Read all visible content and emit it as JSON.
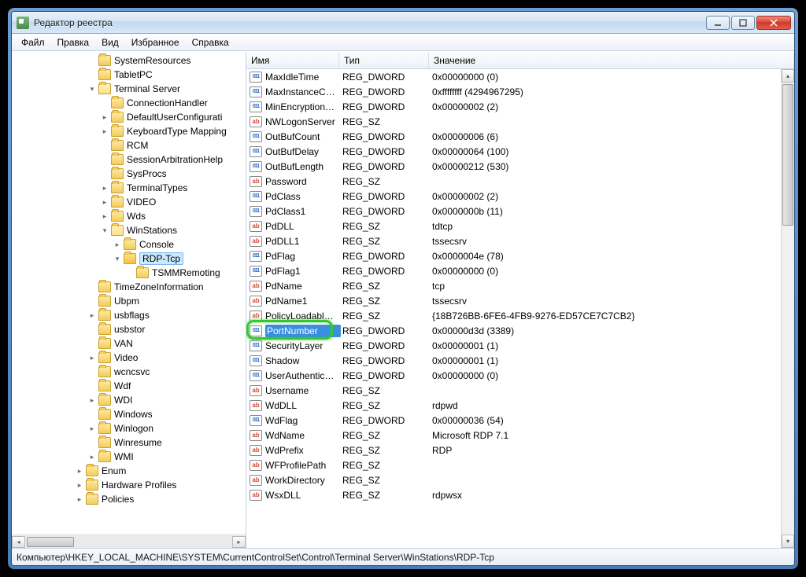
{
  "window": {
    "title": "Редактор реестра"
  },
  "menu": {
    "file": "Файл",
    "edit": "Правка",
    "view": "Вид",
    "favorites": "Избранное",
    "help": "Справка"
  },
  "headers": {
    "name": "Имя",
    "type": "Тип",
    "value": "Значение"
  },
  "tree": [
    {
      "depth": 6,
      "exp": "",
      "label": "SystemResources"
    },
    {
      "depth": 6,
      "exp": "",
      "label": "TabletPC"
    },
    {
      "depth": 6,
      "exp": "▾",
      "label": "Terminal Server",
      "open": true
    },
    {
      "depth": 7,
      "exp": "",
      "label": "ConnectionHandler"
    },
    {
      "depth": 7,
      "exp": "▸",
      "label": "DefaultUserConfigurati"
    },
    {
      "depth": 7,
      "exp": "▸",
      "label": "KeyboardType Mapping"
    },
    {
      "depth": 7,
      "exp": "",
      "label": "RCM"
    },
    {
      "depth": 7,
      "exp": "",
      "label": "SessionArbitrationHelp"
    },
    {
      "depth": 7,
      "exp": "",
      "label": "SysProcs"
    },
    {
      "depth": 7,
      "exp": "▸",
      "label": "TerminalTypes"
    },
    {
      "depth": 7,
      "exp": "▸",
      "label": "VIDEO"
    },
    {
      "depth": 7,
      "exp": "▸",
      "label": "Wds"
    },
    {
      "depth": 7,
      "exp": "▾",
      "label": "WinStations",
      "open": true
    },
    {
      "depth": 8,
      "exp": "▸",
      "label": "Console"
    },
    {
      "depth": 8,
      "exp": "▾",
      "label": "RDP-Tcp",
      "open": true,
      "selected": true
    },
    {
      "depth": 9,
      "exp": "",
      "label": "TSMMRemoting"
    },
    {
      "depth": 6,
      "exp": "",
      "label": "TimeZoneInformation"
    },
    {
      "depth": 6,
      "exp": "",
      "label": "Ubpm"
    },
    {
      "depth": 6,
      "exp": "▸",
      "label": "usbflags"
    },
    {
      "depth": 6,
      "exp": "",
      "label": "usbstor"
    },
    {
      "depth": 6,
      "exp": "",
      "label": "VAN"
    },
    {
      "depth": 6,
      "exp": "▸",
      "label": "Video"
    },
    {
      "depth": 6,
      "exp": "",
      "label": "wcncsvc"
    },
    {
      "depth": 6,
      "exp": "",
      "label": "Wdf"
    },
    {
      "depth": 6,
      "exp": "▸",
      "label": "WDI"
    },
    {
      "depth": 6,
      "exp": "",
      "label": "Windows"
    },
    {
      "depth": 6,
      "exp": "▸",
      "label": "Winlogon"
    },
    {
      "depth": 6,
      "exp": "",
      "label": "Winresume"
    },
    {
      "depth": 6,
      "exp": "▸",
      "label": "WMI"
    },
    {
      "depth": 5,
      "exp": "▸",
      "label": "Enum"
    },
    {
      "depth": 5,
      "exp": "▸",
      "label": "Hardware Profiles"
    },
    {
      "depth": 5,
      "exp": "▸",
      "label": "Policies"
    }
  ],
  "values": [
    {
      "icon": "dw",
      "name": "MaxIdleTime",
      "type": "REG_DWORD",
      "value": "0x00000000 (0)"
    },
    {
      "icon": "dw",
      "name": "MaxInstanceCo...",
      "type": "REG_DWORD",
      "value": "0xffffffff (4294967295)"
    },
    {
      "icon": "dw",
      "name": "MinEncryptionL...",
      "type": "REG_DWORD",
      "value": "0x00000002 (2)"
    },
    {
      "icon": "sz",
      "name": "NWLogonServer",
      "type": "REG_SZ",
      "value": ""
    },
    {
      "icon": "dw",
      "name": "OutBufCount",
      "type": "REG_DWORD",
      "value": "0x00000006 (6)"
    },
    {
      "icon": "dw",
      "name": "OutBufDelay",
      "type": "REG_DWORD",
      "value": "0x00000064 (100)"
    },
    {
      "icon": "dw",
      "name": "OutBufLength",
      "type": "REG_DWORD",
      "value": "0x00000212 (530)"
    },
    {
      "icon": "sz",
      "name": "Password",
      "type": "REG_SZ",
      "value": ""
    },
    {
      "icon": "dw",
      "name": "PdClass",
      "type": "REG_DWORD",
      "value": "0x00000002 (2)"
    },
    {
      "icon": "dw",
      "name": "PdClass1",
      "type": "REG_DWORD",
      "value": "0x0000000b (11)"
    },
    {
      "icon": "sz",
      "name": "PdDLL",
      "type": "REG_SZ",
      "value": "tdtcp"
    },
    {
      "icon": "sz",
      "name": "PdDLL1",
      "type": "REG_SZ",
      "value": "tssecsrv"
    },
    {
      "icon": "dw",
      "name": "PdFlag",
      "type": "REG_DWORD",
      "value": "0x0000004e (78)"
    },
    {
      "icon": "dw",
      "name": "PdFlag1",
      "type": "REG_DWORD",
      "value": "0x00000000 (0)"
    },
    {
      "icon": "sz",
      "name": "PdName",
      "type": "REG_SZ",
      "value": "tcp"
    },
    {
      "icon": "sz",
      "name": "PdName1",
      "type": "REG_SZ",
      "value": "tssecsrv"
    },
    {
      "icon": "sz",
      "name": "PolicyLoadableP...",
      "type": "REG_SZ",
      "value": "{18B726BB-6FE6-4FB9-9276-ED57CE7C7CB2}"
    },
    {
      "icon": "dw",
      "name": "PortNumber",
      "type": "REG_DWORD",
      "value": "0x00000d3d (3389)",
      "selected": true,
      "highlight": true
    },
    {
      "icon": "dw",
      "name": "SecurityLayer",
      "type": "REG_DWORD",
      "value": "0x00000001 (1)"
    },
    {
      "icon": "dw",
      "name": "Shadow",
      "type": "REG_DWORD",
      "value": "0x00000001 (1)"
    },
    {
      "icon": "dw",
      "name": "UserAuthenticat...",
      "type": "REG_DWORD",
      "value": "0x00000000 (0)"
    },
    {
      "icon": "sz",
      "name": "Username",
      "type": "REG_SZ",
      "value": ""
    },
    {
      "icon": "sz",
      "name": "WdDLL",
      "type": "REG_SZ",
      "value": "rdpwd"
    },
    {
      "icon": "dw",
      "name": "WdFlag",
      "type": "REG_DWORD",
      "value": "0x00000036 (54)"
    },
    {
      "icon": "sz",
      "name": "WdName",
      "type": "REG_SZ",
      "value": "Microsoft RDP 7.1"
    },
    {
      "icon": "sz",
      "name": "WdPrefix",
      "type": "REG_SZ",
      "value": "RDP"
    },
    {
      "icon": "sz",
      "name": "WFProfilePath",
      "type": "REG_SZ",
      "value": ""
    },
    {
      "icon": "sz",
      "name": "WorkDirectory",
      "type": "REG_SZ",
      "value": ""
    },
    {
      "icon": "sz",
      "name": "WsxDLL",
      "type": "REG_SZ",
      "value": "rdpwsx"
    }
  ],
  "statusbar": {
    "path": "Компьютер\\HKEY_LOCAL_MACHINE\\SYSTEM\\CurrentControlSet\\Control\\Terminal Server\\WinStations\\RDP-Tcp"
  }
}
